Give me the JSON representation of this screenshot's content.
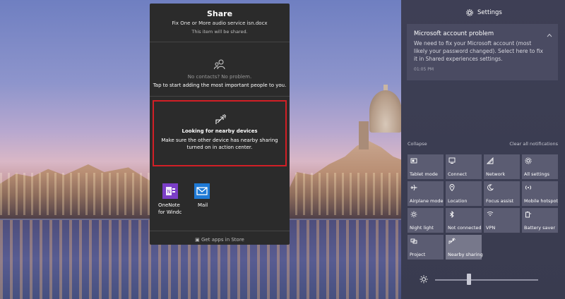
{
  "share": {
    "title": "Share",
    "file_name": "Fix One or More audio service isn.docx",
    "note": "This item will be shared.",
    "contacts_heading": "No contacts? No problem.",
    "contacts_desc": "Tap to start adding the most important people to you.",
    "nearby_heading": "Looking for nearby devices",
    "nearby_desc": "Make sure the other device has nearby sharing turned on in action center.",
    "apps": [
      {
        "label_line1": "OneNote",
        "label_line2": "for Windc",
        "icon": "onenote-icon",
        "color": "#7b3ec7"
      },
      {
        "label_line1": "Mail",
        "label_line2": "",
        "icon": "mail-icon",
        "color": "#1f7ad6"
      }
    ],
    "store_link": "Get apps in Store"
  },
  "action_center": {
    "settings_label": "Settings",
    "notification": {
      "title": "Microsoft account problem",
      "body": "We need to fix your Microsoft account (most likely your password changed). Select here to fix it in Shared experiences settings.",
      "time": "01:05 PM"
    },
    "collapse_label": "Collapse",
    "clear_label": "Clear all notifications",
    "quick_actions": [
      {
        "label": "Tablet mode",
        "icon": "tablet-mode-icon",
        "active": false
      },
      {
        "label": "Connect",
        "icon": "connect-icon",
        "active": false
      },
      {
        "label": "Network",
        "icon": "network-icon",
        "active": false
      },
      {
        "label": "All settings",
        "icon": "gear-icon",
        "active": false
      },
      {
        "label": "Airplane mode",
        "icon": "airplane-icon",
        "active": false
      },
      {
        "label": "Location",
        "icon": "location-icon",
        "active": false
      },
      {
        "label": "Focus assist",
        "icon": "moon-icon",
        "active": false
      },
      {
        "label": "Mobile hotspot",
        "icon": "hotspot-icon",
        "active": false
      },
      {
        "label": "Night light",
        "icon": "night-light-icon",
        "active": false
      },
      {
        "label": "Not connected",
        "icon": "bluetooth-icon",
        "active": false
      },
      {
        "label": "VPN",
        "icon": "vpn-icon",
        "active": false
      },
      {
        "label": "Battery saver",
        "icon": "battery-saver-icon",
        "active": false
      },
      {
        "label": "Project",
        "icon": "project-icon",
        "active": false
      },
      {
        "label": "Nearby sharing",
        "icon": "nearby-sharing-icon",
        "active": true
      }
    ],
    "brightness_level": 0.33
  },
  "colors": {
    "highlight_border": "#d21f26",
    "share_bg": "#2b2b2b",
    "tile_bg": "#5b5c72",
    "tile_active_bg": "#77788b"
  }
}
